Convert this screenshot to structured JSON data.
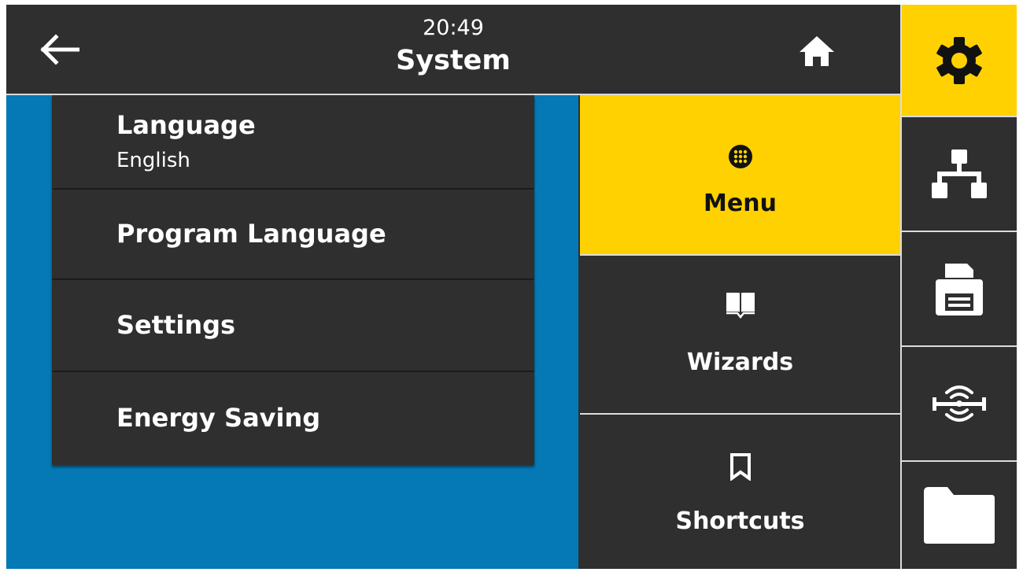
{
  "header": {
    "time": "20:49",
    "title": "System",
    "back_icon": "arrow-left-icon",
    "home_icon": "home-icon"
  },
  "list": {
    "items": [
      {
        "label": "Language",
        "value": "English"
      },
      {
        "label": "Program Language"
      },
      {
        "label": "Settings"
      },
      {
        "label": "Energy Saving"
      }
    ]
  },
  "menu": {
    "buttons": [
      {
        "label": "Menu",
        "icon": "grid-dots-icon",
        "selected": true
      },
      {
        "label": "Wizards",
        "icon": "book-icon",
        "selected": false
      },
      {
        "label": "Shortcuts",
        "icon": "bookmark-icon",
        "selected": false
      }
    ]
  },
  "sidebar": {
    "items": [
      {
        "icon": "gear-icon",
        "selected": true
      },
      {
        "icon": "network-icon",
        "selected": false
      },
      {
        "icon": "printer-icon",
        "selected": false
      },
      {
        "icon": "rfid-icon",
        "selected": false
      },
      {
        "icon": "folder-icon",
        "selected": false
      }
    ]
  },
  "colors": {
    "background": "#2f2f2f",
    "accent": "#ffd100",
    "content_blue": "#0579b5",
    "text": "#ffffff",
    "divider": "#dcdcdc"
  }
}
